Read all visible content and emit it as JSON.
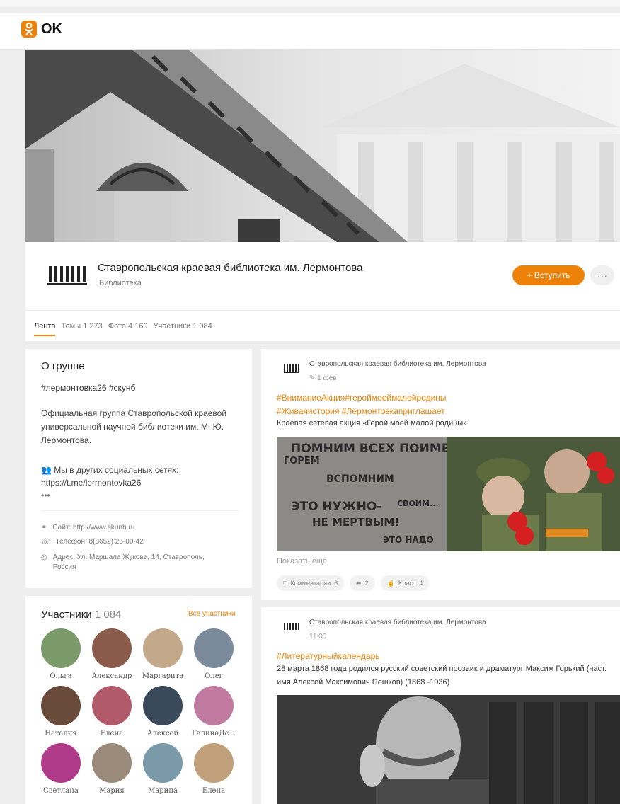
{
  "app": {
    "logo_text": "OK"
  },
  "group": {
    "title": "Ставропольская краевая библиотека им. Лермонтова",
    "subtitle": "Библиотека",
    "join_label": "+ Вступить",
    "more_label": "···"
  },
  "tabs": [
    {
      "label": "Лента"
    },
    {
      "label": "Темы 1 273"
    },
    {
      "label": "Фото 4 169"
    },
    {
      "label": "Участники 1 084"
    }
  ],
  "about": {
    "title": "О группе",
    "tags": "#лермонтовка26 #скунб",
    "description": "Официальная группа Ставропольской краевой универсальной научной библиотеки им. М. Ю. Лермонтова.",
    "social_label": "Мы в других социальных сетях:",
    "social_link": "https://t.me/lermontovka26",
    "dots": "•••",
    "site": "Сайт: http://www.skunb.ru",
    "phone": "Телефон: 8(8652) 26-00-42",
    "address": "Адрес: Ул. Маршала Жукова, 14, Ставрополь, Россия"
  },
  "members": {
    "title": "Участники",
    "count": "1 084",
    "all_label": "Все участники",
    "list": [
      {
        "name": "Ольга",
        "color": "#7a9a6a"
      },
      {
        "name": "Александр",
        "color": "#8a5a4a"
      },
      {
        "name": "Маргарита",
        "color": "#c4a88a"
      },
      {
        "name": "Олег",
        "color": "#7a8a9a"
      },
      {
        "name": "Наталия",
        "color": "#6a4a3a"
      },
      {
        "name": "Елена",
        "color": "#b05a6a"
      },
      {
        "name": "Алексей",
        "color": "#3a4a5a"
      },
      {
        "name": "ГалинаДе...",
        "color": "#c07aa0"
      },
      {
        "name": "Светлана",
        "color": "#b03a8a"
      },
      {
        "name": "Мария",
        "color": "#9a8a7a"
      },
      {
        "name": "Марина",
        "color": "#7a9aaa"
      },
      {
        "name": "Елена",
        "color": "#c0a07a"
      }
    ]
  },
  "posts": [
    {
      "author": "Ставропольская краевая библиотека им. Лермонтова",
      "time": "1 фев",
      "tag1": "#ВниманиеАкция#героймоеймалойродины",
      "tag2": "#Живаяистория #Лермонтовкаприглашает",
      "text": "Краевая сетевая акция «Герой моей малой родины»",
      "image_text": [
        "ПОМНИМ ВСЕХ ПОИМЕННО,",
        "ГОРЕМ",
        "ВСПОМНИМ",
        "СВОИМ...",
        "ЭТО НУЖНО-",
        "НЕ МЕРТВЫМ!",
        "ЭТО НАДО"
      ],
      "show_more": "Показать еще",
      "comments_label": "Комментарии",
      "comments_count": "6",
      "shares_count": "2",
      "likes_label": "Класс",
      "likes_count": "4"
    },
    {
      "author": "Ставропольская краевая библиотека им. Лермонтова",
      "time": "11:00",
      "tag1": "#Литературныйкалендарь",
      "text": "28 марта 1868 года родился русский советский прозаик и драматург Максим Горький (наст. имя Алексей Максимович Пешков) (1868 -1936)"
    }
  ],
  "colors": {
    "accent": "#ee8208",
    "background": "#eeeeee",
    "card": "#ffffff"
  },
  "icons": [
    "ok-logo-icon",
    "edit-icon",
    "people-icon",
    "link-icon",
    "phone-icon",
    "location-icon",
    "comment-icon",
    "share-icon",
    "like-icon"
  ]
}
